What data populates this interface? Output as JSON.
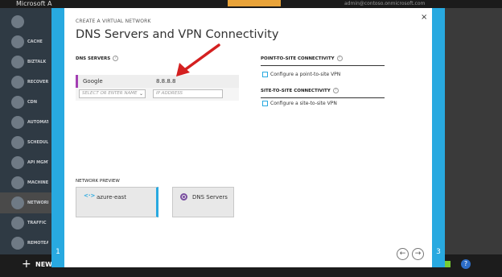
{
  "app": {
    "brand": "Microsoft A",
    "account": "admin@contoso.onmicrosoft.com"
  },
  "sidebar": {
    "items": [
      {
        "label": "",
        "icon": "visual-studio-icon"
      },
      {
        "label": "CACHE",
        "icon": "cache-icon"
      },
      {
        "label": "BIZTALK",
        "icon": "biztalk-icon"
      },
      {
        "label": "RECOVERY",
        "icon": "recovery-icon"
      },
      {
        "label": "CDN",
        "icon": "cdn-icon"
      },
      {
        "label": "AUTOMATION",
        "icon": "automation-icon"
      },
      {
        "label": "SCHEDULER",
        "icon": "scheduler-icon"
      },
      {
        "label": "API MGMT",
        "icon": "api-icon"
      },
      {
        "label": "MACHINE",
        "icon": "machine-learning-icon"
      },
      {
        "label": "NETWORKS",
        "icon": "networks-icon"
      },
      {
        "label": "TRAFFIC",
        "icon": "traffic-icon"
      },
      {
        "label": "REMOTEAPP",
        "icon": "remoteapp-icon"
      }
    ]
  },
  "bottom": {
    "new_label": "NEW",
    "plus": "+",
    "help": "?"
  },
  "wizard": {
    "eyebrow": "CREATE A VIRTUAL NETWORK",
    "title": "DNS Servers and VPN Connectivity",
    "close": "×",
    "step_left": "1",
    "step_right": "3",
    "dns_section": "DNS SERVERS",
    "dns_entries": [
      {
        "name": "Google",
        "ip": "8.8.8.8"
      }
    ],
    "select_placeholder": "SELECT OR ENTER NAME",
    "ip_placeholder": "IP ADDRESS",
    "p2s_section": "POINT-TO-SITE CONNECTIVITY",
    "p2s_checkbox": "Configure a point-to-site VPN",
    "s2s_section": "SITE-TO-SITE CONNECTIVITY",
    "s2s_checkbox": "Configure a site-to-site VPN",
    "preview_label": "NETWORK PREVIEW",
    "preview_tiles": [
      {
        "label": "azure-east",
        "icon": "<·>"
      },
      {
        "label": "DNS Servers"
      }
    ],
    "prev": "←",
    "next": "→"
  },
  "colors": {
    "accent": "#28a9e0",
    "annotation_arrow": "#d42020",
    "dns_marker": "#a33fb3"
  }
}
